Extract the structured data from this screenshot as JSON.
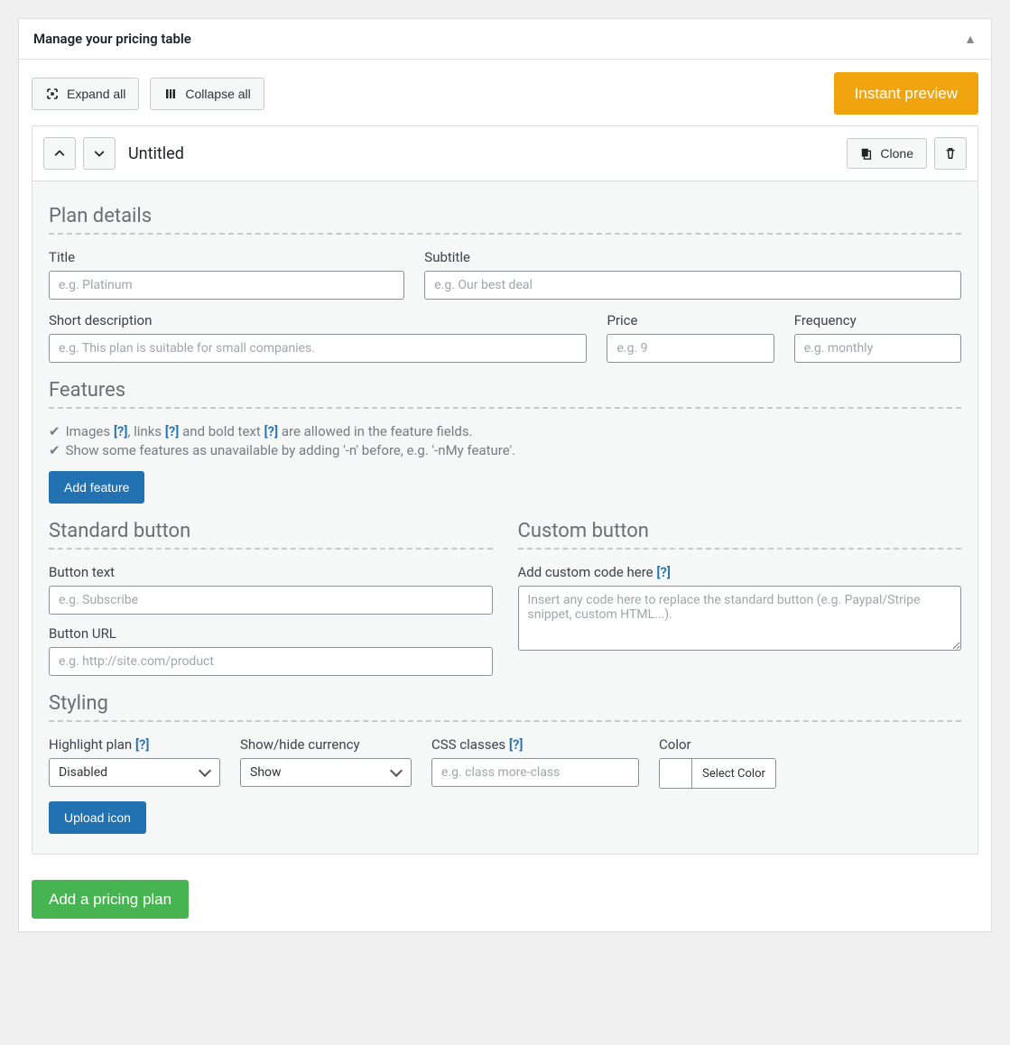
{
  "header": {
    "title": "Manage your pricing table"
  },
  "toolbar": {
    "expand_all": "Expand all",
    "collapse_all": "Collapse all",
    "instant_preview": "Instant preview"
  },
  "plan": {
    "title": "Untitled",
    "clone_label": "Clone"
  },
  "sections": {
    "plan_details": "Plan details",
    "features": "Features",
    "standard_button": "Standard button",
    "custom_button": "Custom button",
    "styling": "Styling"
  },
  "fields": {
    "title": {
      "label": "Title",
      "placeholder": "e.g. Platinum",
      "value": ""
    },
    "subtitle": {
      "label": "Subtitle",
      "placeholder": "e.g. Our best deal",
      "value": ""
    },
    "short_desc": {
      "label": "Short description",
      "placeholder": "e.g. This plan is suitable for small companies.",
      "value": ""
    },
    "price": {
      "label": "Price",
      "placeholder": "e.g. 9",
      "value": ""
    },
    "frequency": {
      "label": "Frequency",
      "placeholder": "e.g. monthly",
      "value": ""
    },
    "button_text": {
      "label": "Button text",
      "placeholder": "e.g. Subscribe",
      "value": ""
    },
    "button_url": {
      "label": "Button URL",
      "placeholder": "e.g. http://site.com/product",
      "value": ""
    },
    "custom_code": {
      "label": "Add custom code here",
      "placeholder": "Insert any code here to replace the standard button (e.g. Paypal/Stripe snippet, custom HTML...).",
      "value": ""
    },
    "highlight": {
      "label": "Highlight plan",
      "value": "Disabled"
    },
    "show_currency": {
      "label": "Show/hide currency",
      "value": "Show"
    },
    "css_classes": {
      "label": "CSS classes",
      "placeholder": "e.g. class more-class",
      "value": ""
    },
    "color": {
      "label": "Color",
      "button": "Select Color"
    }
  },
  "features_notes": {
    "line1_a": "Images",
    "line1_b": ", links",
    "line1_c": "and bold text",
    "line1_d": "are allowed in the feature fields.",
    "line2": "Show some features as unavailable by adding '-n' before, e.g. '-nMy feature'.",
    "help": "[?]"
  },
  "buttons": {
    "add_feature": "Add feature",
    "upload_icon": "Upload icon",
    "add_plan": "Add a pricing plan"
  }
}
